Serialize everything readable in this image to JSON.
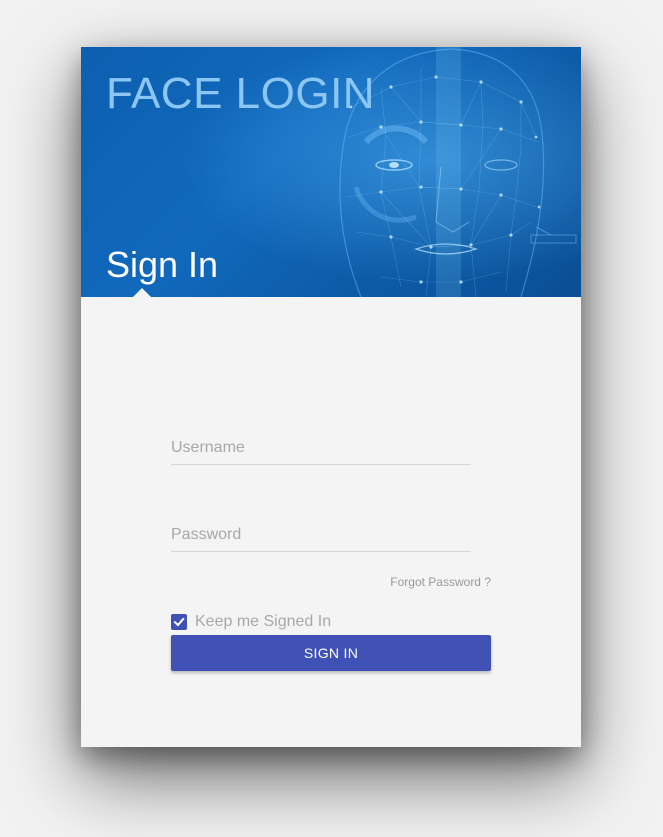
{
  "header": {
    "brand_title": "FACE LOGIN",
    "subtitle": "Sign In",
    "background_image": "face-mesh-illustration"
  },
  "form": {
    "username": {
      "value": "",
      "placeholder": "Username"
    },
    "password": {
      "value": "",
      "placeholder": "Password"
    },
    "forgot_password": "Forgot Password ?",
    "remember_me": {
      "label": "Keep me Signed In",
      "checked": true
    },
    "submit_label": "SIGN IN"
  },
  "colors": {
    "header_blue": "#1169bc",
    "brand_title": "#8cc6f2",
    "primary_button": "#3f51b5",
    "card_background": "#f4f4f4"
  },
  "icons": {
    "checkbox": "check-icon"
  }
}
